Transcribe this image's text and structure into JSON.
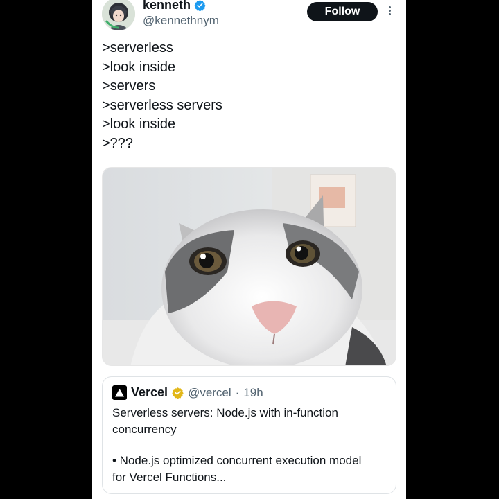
{
  "author": {
    "name": "kenneth",
    "handle": "@kennethnym",
    "avatar_icon": "anime-character-avatar",
    "verified_color": "#1d9bf0"
  },
  "header": {
    "follow_label": "Follow",
    "more_icon": "vertical-ellipsis-icon"
  },
  "tweet": {
    "lines": [
      ">serverless",
      ">look inside",
      ">servers",
      ">serverless servers",
      ">look inside",
      ">???"
    ]
  },
  "media": {
    "alt_icon": "cat-closeup-photo"
  },
  "quote": {
    "name": "Vercel",
    "handle": "@vercel",
    "separator": "·",
    "time": "19h",
    "logo_icon": "vercel-triangle-icon",
    "badge_color": "#e2b719",
    "lines_1": [
      "Serverless servers: Node.js with in-function",
      "concurrency"
    ],
    "lines_2": [
      "• Node.js optimized concurrent execution model",
      "for Vercel Functions..."
    ]
  },
  "colors": {
    "background": "#000000",
    "card": "#ffffff",
    "text": "#0f1419",
    "muted": "#536471"
  }
}
